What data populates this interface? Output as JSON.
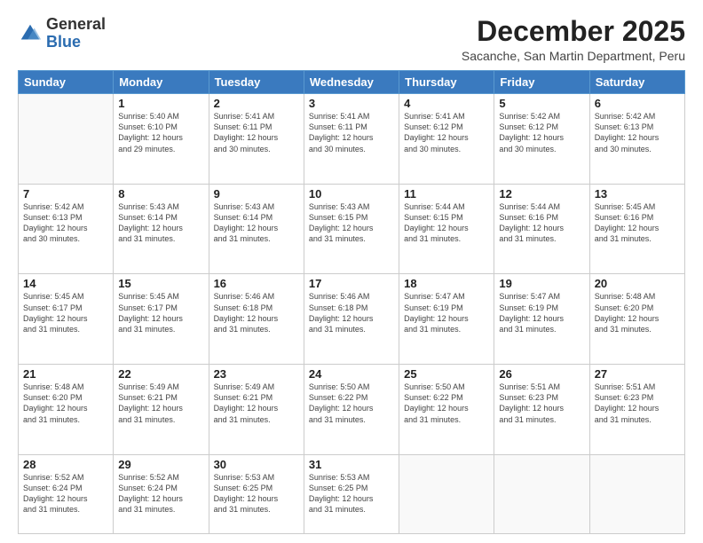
{
  "header": {
    "logo": {
      "general": "General",
      "blue": "Blue"
    },
    "title": "December 2025",
    "location": "Sacanche, San Martin Department, Peru"
  },
  "days_of_week": [
    "Sunday",
    "Monday",
    "Tuesday",
    "Wednesday",
    "Thursday",
    "Friday",
    "Saturday"
  ],
  "weeks": [
    [
      {
        "day": "",
        "info": ""
      },
      {
        "day": "1",
        "info": "Sunrise: 5:40 AM\nSunset: 6:10 PM\nDaylight: 12 hours\nand 29 minutes."
      },
      {
        "day": "2",
        "info": "Sunrise: 5:41 AM\nSunset: 6:11 PM\nDaylight: 12 hours\nand 30 minutes."
      },
      {
        "day": "3",
        "info": "Sunrise: 5:41 AM\nSunset: 6:11 PM\nDaylight: 12 hours\nand 30 minutes."
      },
      {
        "day": "4",
        "info": "Sunrise: 5:41 AM\nSunset: 6:12 PM\nDaylight: 12 hours\nand 30 minutes."
      },
      {
        "day": "5",
        "info": "Sunrise: 5:42 AM\nSunset: 6:12 PM\nDaylight: 12 hours\nand 30 minutes."
      },
      {
        "day": "6",
        "info": "Sunrise: 5:42 AM\nSunset: 6:13 PM\nDaylight: 12 hours\nand 30 minutes."
      }
    ],
    [
      {
        "day": "7",
        "info": "Sunrise: 5:42 AM\nSunset: 6:13 PM\nDaylight: 12 hours\nand 30 minutes."
      },
      {
        "day": "8",
        "info": "Sunrise: 5:43 AM\nSunset: 6:14 PM\nDaylight: 12 hours\nand 31 minutes."
      },
      {
        "day": "9",
        "info": "Sunrise: 5:43 AM\nSunset: 6:14 PM\nDaylight: 12 hours\nand 31 minutes."
      },
      {
        "day": "10",
        "info": "Sunrise: 5:43 AM\nSunset: 6:15 PM\nDaylight: 12 hours\nand 31 minutes."
      },
      {
        "day": "11",
        "info": "Sunrise: 5:44 AM\nSunset: 6:15 PM\nDaylight: 12 hours\nand 31 minutes."
      },
      {
        "day": "12",
        "info": "Sunrise: 5:44 AM\nSunset: 6:16 PM\nDaylight: 12 hours\nand 31 minutes."
      },
      {
        "day": "13",
        "info": "Sunrise: 5:45 AM\nSunset: 6:16 PM\nDaylight: 12 hours\nand 31 minutes."
      }
    ],
    [
      {
        "day": "14",
        "info": "Sunrise: 5:45 AM\nSunset: 6:17 PM\nDaylight: 12 hours\nand 31 minutes."
      },
      {
        "day": "15",
        "info": "Sunrise: 5:45 AM\nSunset: 6:17 PM\nDaylight: 12 hours\nand 31 minutes."
      },
      {
        "day": "16",
        "info": "Sunrise: 5:46 AM\nSunset: 6:18 PM\nDaylight: 12 hours\nand 31 minutes."
      },
      {
        "day": "17",
        "info": "Sunrise: 5:46 AM\nSunset: 6:18 PM\nDaylight: 12 hours\nand 31 minutes."
      },
      {
        "day": "18",
        "info": "Sunrise: 5:47 AM\nSunset: 6:19 PM\nDaylight: 12 hours\nand 31 minutes."
      },
      {
        "day": "19",
        "info": "Sunrise: 5:47 AM\nSunset: 6:19 PM\nDaylight: 12 hours\nand 31 minutes."
      },
      {
        "day": "20",
        "info": "Sunrise: 5:48 AM\nSunset: 6:20 PM\nDaylight: 12 hours\nand 31 minutes."
      }
    ],
    [
      {
        "day": "21",
        "info": "Sunrise: 5:48 AM\nSunset: 6:20 PM\nDaylight: 12 hours\nand 31 minutes."
      },
      {
        "day": "22",
        "info": "Sunrise: 5:49 AM\nSunset: 6:21 PM\nDaylight: 12 hours\nand 31 minutes."
      },
      {
        "day": "23",
        "info": "Sunrise: 5:49 AM\nSunset: 6:21 PM\nDaylight: 12 hours\nand 31 minutes."
      },
      {
        "day": "24",
        "info": "Sunrise: 5:50 AM\nSunset: 6:22 PM\nDaylight: 12 hours\nand 31 minutes."
      },
      {
        "day": "25",
        "info": "Sunrise: 5:50 AM\nSunset: 6:22 PM\nDaylight: 12 hours\nand 31 minutes."
      },
      {
        "day": "26",
        "info": "Sunrise: 5:51 AM\nSunset: 6:23 PM\nDaylight: 12 hours\nand 31 minutes."
      },
      {
        "day": "27",
        "info": "Sunrise: 5:51 AM\nSunset: 6:23 PM\nDaylight: 12 hours\nand 31 minutes."
      }
    ],
    [
      {
        "day": "28",
        "info": "Sunrise: 5:52 AM\nSunset: 6:24 PM\nDaylight: 12 hours\nand 31 minutes."
      },
      {
        "day": "29",
        "info": "Sunrise: 5:52 AM\nSunset: 6:24 PM\nDaylight: 12 hours\nand 31 minutes."
      },
      {
        "day": "30",
        "info": "Sunrise: 5:53 AM\nSunset: 6:25 PM\nDaylight: 12 hours\nand 31 minutes."
      },
      {
        "day": "31",
        "info": "Sunrise: 5:53 AM\nSunset: 6:25 PM\nDaylight: 12 hours\nand 31 minutes."
      },
      {
        "day": "",
        "info": ""
      },
      {
        "day": "",
        "info": ""
      },
      {
        "day": "",
        "info": ""
      }
    ]
  ]
}
